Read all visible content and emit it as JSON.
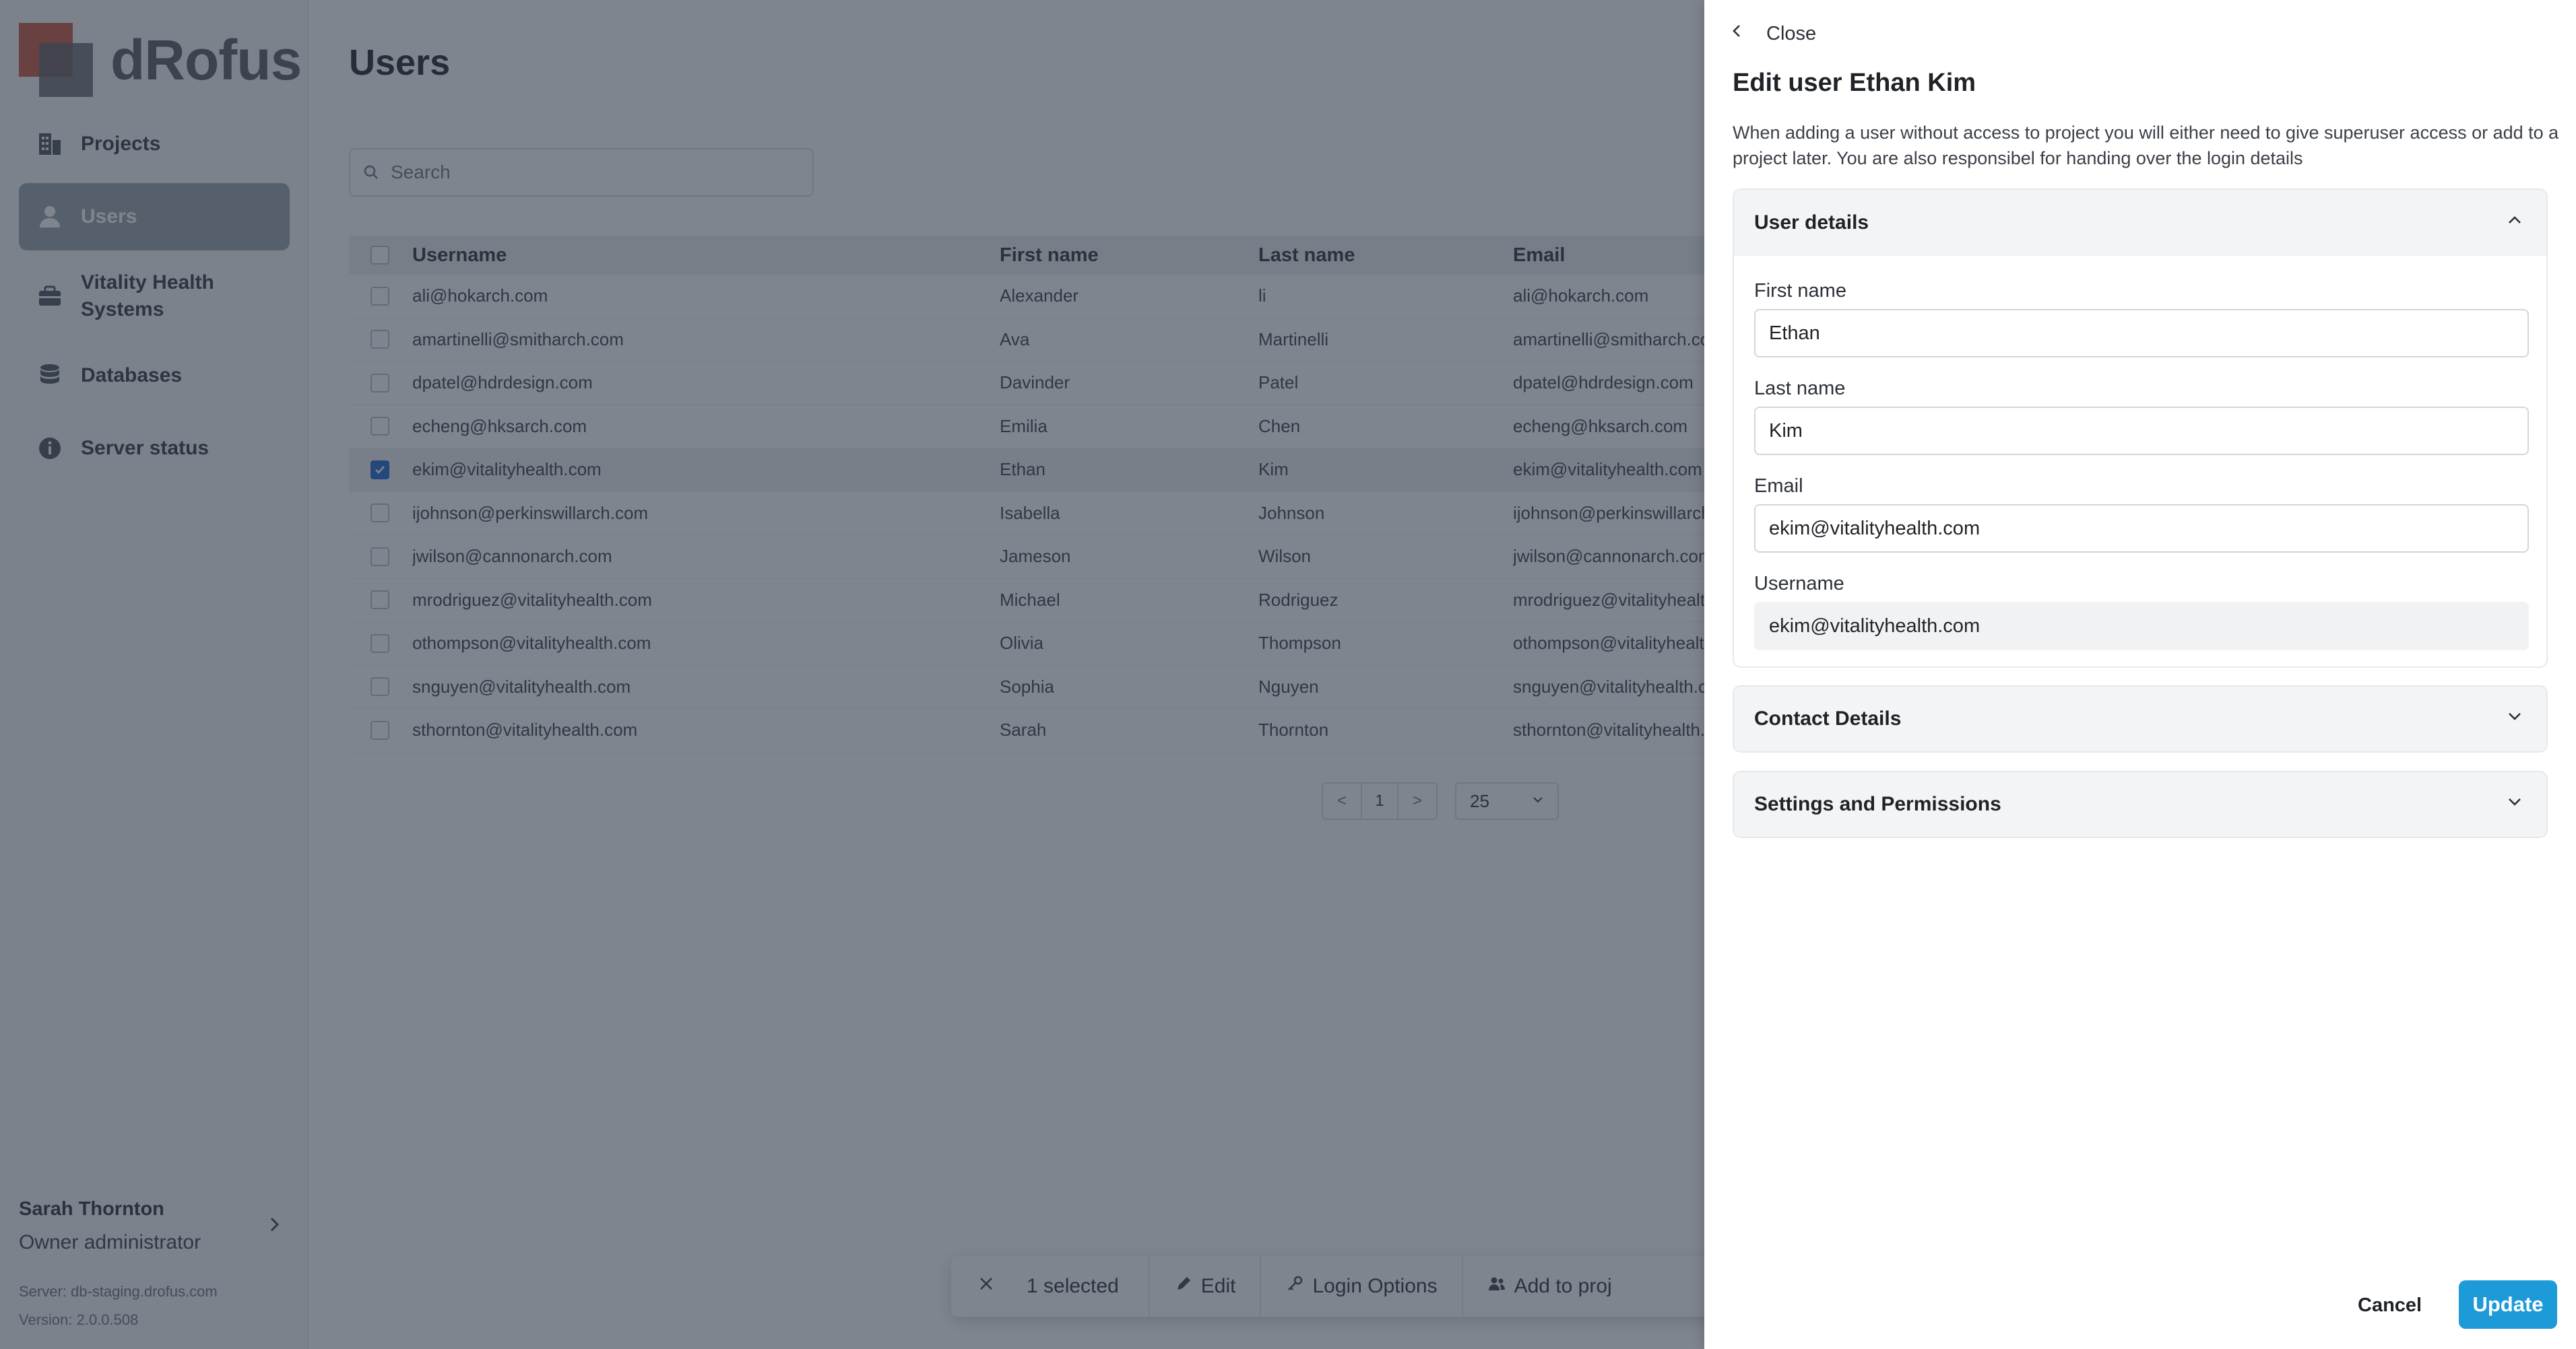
{
  "app": {
    "logo_text": "dRofus",
    "brand_colors": {
      "logo_red": "#c8553d",
      "logo_gray": "#5c5f66",
      "accent": "#1d9bd8",
      "checkbox": "#1e66d0"
    }
  },
  "sidebar": {
    "items": [
      {
        "label": "Projects",
        "icon": "building-icon",
        "active": false
      },
      {
        "label": "Users",
        "icon": "user-icon",
        "active": true
      },
      {
        "label": "Vitality Health Systems",
        "icon": "briefcase-icon",
        "active": false
      },
      {
        "label": "Databases",
        "icon": "database-icon",
        "active": false
      },
      {
        "label": "Server status",
        "icon": "info-icon",
        "active": false
      }
    ],
    "user": {
      "name": "Sarah Thornton",
      "role": "Owner administrator"
    },
    "server": "Server: db-staging.drofus.com",
    "version": "Version: 2.0.0.508"
  },
  "main": {
    "title": "Users",
    "search": {
      "placeholder": "Search",
      "value": ""
    },
    "table": {
      "columns": [
        "Username",
        "First name",
        "Last name",
        "Email"
      ],
      "rows": [
        {
          "username": "ali@hokarch.com",
          "first": "Alexander",
          "last": "li",
          "email": "ali@hokarch.com",
          "selected": false
        },
        {
          "username": "amartinelli@smitharch.com",
          "first": "Ava",
          "last": "Martinelli",
          "email": "amartinelli@smitharch.com",
          "selected": false
        },
        {
          "username": "dpatel@hdrdesign.com",
          "first": "Davinder",
          "last": "Patel",
          "email": "dpatel@hdrdesign.com",
          "selected": false
        },
        {
          "username": "echeng@hksarch.com",
          "first": "Emilia",
          "last": "Chen",
          "email": "echeng@hksarch.com",
          "selected": false
        },
        {
          "username": "ekim@vitalityhealth.com",
          "first": "Ethan",
          "last": "Kim",
          "email": "ekim@vitalityhealth.com",
          "selected": true
        },
        {
          "username": "ijohnson@perkinswillarch.com",
          "first": "Isabella",
          "last": "Johnson",
          "email": "ijohnson@perkinswillarch.com",
          "selected": false
        },
        {
          "username": "jwilson@cannonarch.com",
          "first": "Jameson",
          "last": "Wilson",
          "email": "jwilson@cannonarch.com",
          "selected": false
        },
        {
          "username": "mrodriguez@vitalityhealth.com",
          "first": "Michael",
          "last": "Rodriguez",
          "email": "mrodriguez@vitalityhealth.com",
          "selected": false
        },
        {
          "username": "othompson@vitalityhealth.com",
          "first": "Olivia",
          "last": "Thompson",
          "email": "othompson@vitalityhealth.com",
          "selected": false
        },
        {
          "username": "snguyen@vitalityhealth.com",
          "first": "Sophia",
          "last": "Nguyen",
          "email": "snguyen@vitalityhealth.com",
          "selected": false
        },
        {
          "username": "sthornton@vitalityhealth.com",
          "first": "Sarah",
          "last": "Thornton",
          "email": "sthornton@vitalityhealth.com",
          "selected": false
        }
      ]
    },
    "pagination": {
      "prev": "<",
      "page": "1",
      "next": ">",
      "page_size": "25"
    },
    "action_bar": {
      "selected_text": "1 selected",
      "edit_label": "Edit",
      "login_options_label": "Login Options",
      "add_to_project_label": "Add to proj"
    }
  },
  "drawer": {
    "close_label": "Close",
    "title": "Edit user Ethan Kim",
    "description": "When adding a user without access to project you will either need to give superuser access or add to a project later. You are also responsibel for handing over the login details",
    "sections": {
      "user_details": {
        "title": "User details",
        "expanded": true,
        "first_name_label": "First name",
        "first_name_value": "Ethan",
        "last_name_label": "Last name",
        "last_name_value": "Kim",
        "email_label": "Email",
        "email_value": "ekim@vitalityhealth.com",
        "username_label": "Username",
        "username_value": "ekim@vitalityhealth.com"
      },
      "contact_details": {
        "title": "Contact Details",
        "expanded": false
      },
      "settings_permissions": {
        "title": "Settings and Permissions",
        "expanded": false
      }
    },
    "cancel_label": "Cancel",
    "update_label": "Update"
  }
}
